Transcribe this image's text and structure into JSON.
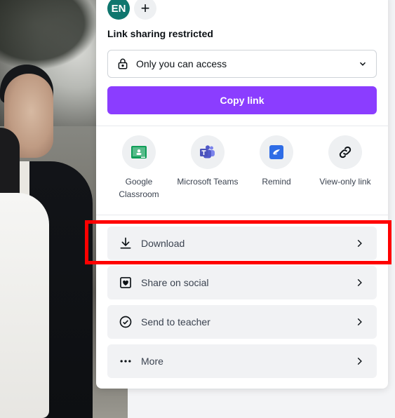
{
  "avatars": {
    "initials": "EN",
    "add_label": "+"
  },
  "sharing": {
    "title": "Link sharing restricted",
    "access_option": "Only you can access",
    "copy_label": "Copy link"
  },
  "share_targets": [
    {
      "label": "Google Classroom",
      "icon": "google-classroom-icon"
    },
    {
      "label": "Microsoft Teams",
      "icon": "microsoft-teams-icon"
    },
    {
      "label": "Remind",
      "icon": "remind-icon"
    },
    {
      "label": "View-only link",
      "icon": "link-icon"
    }
  ],
  "actions": [
    {
      "label": "Download",
      "icon": "download-icon"
    },
    {
      "label": "Share on social",
      "icon": "heart-icon"
    },
    {
      "label": "Send to teacher",
      "icon": "check-circle-icon"
    },
    {
      "label": "More",
      "icon": "more-icon"
    }
  ],
  "colors": {
    "accent": "#8b3dff",
    "highlight": "#ff0000",
    "avatar": "#0f766e"
  }
}
